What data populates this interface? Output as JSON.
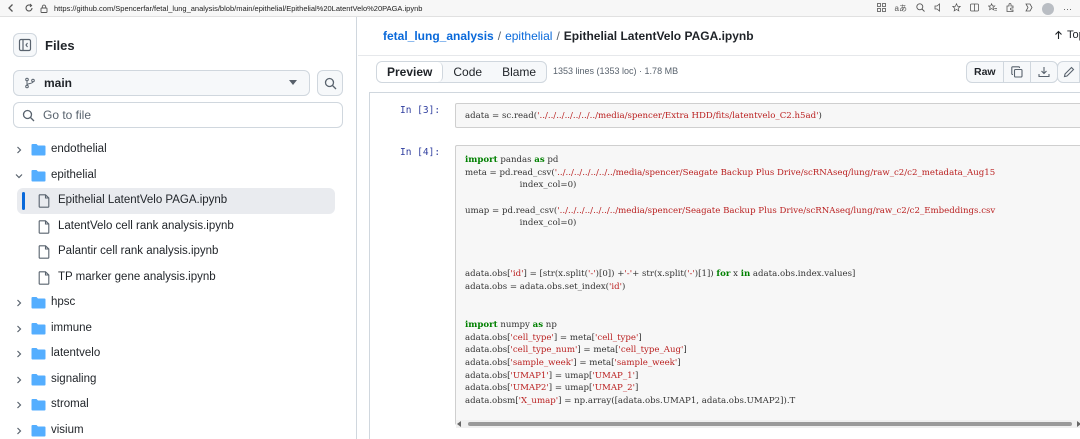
{
  "browser": {
    "url": "https://github.com/Spencerfar/fetal_lung_analysis/blob/main/epithelial/Epithelial%20LatentVelo%20PAGA.ipynb"
  },
  "sidebar": {
    "title": "Files",
    "branch": "main",
    "goto_placeholder": "Go to file",
    "items": [
      {
        "label": "endothelial",
        "type": "folder",
        "expanded": false
      },
      {
        "label": "epithelial",
        "type": "folder",
        "expanded": true
      },
      {
        "label": "Epithelial LatentVelo PAGA.ipynb",
        "type": "file",
        "selected": true
      },
      {
        "label": "LatentVelo cell rank analysis.ipynb",
        "type": "file"
      },
      {
        "label": "Palantir cell rank analysis.ipynb",
        "type": "file"
      },
      {
        "label": "TP marker gene analysis.ipynb",
        "type": "file"
      },
      {
        "label": "hpsc",
        "type": "folder",
        "expanded": false
      },
      {
        "label": "immune",
        "type": "folder",
        "expanded": false
      },
      {
        "label": "latentvelo",
        "type": "folder",
        "expanded": false
      },
      {
        "label": "signaling",
        "type": "folder",
        "expanded": false
      },
      {
        "label": "stromal",
        "type": "folder",
        "expanded": false
      },
      {
        "label": "visium",
        "type": "folder",
        "expanded": false
      }
    ]
  },
  "breadcrumb": {
    "repo": "fetal_lung_analysis",
    "sep": "/",
    "folder": "epithelial",
    "file": "Epithelial LatentVelo PAGA.ipynb"
  },
  "top_button": "Top",
  "toolbar": {
    "tabs": [
      "Preview",
      "Code",
      "Blame"
    ],
    "file_meta": "1353 lines (1353 loc) · 1.78 MB",
    "raw_label": "Raw"
  },
  "cells": [
    {
      "prompt": "In [3]:",
      "lines": [
        [
          [
            "t",
            "adata = sc.read("
          ],
          [
            "s",
            "'../../../../../../../media/spencer/Extra HDD/fits/latentvelo_C2.h5ad'"
          ],
          [
            "t",
            ")"
          ]
        ]
      ]
    },
    {
      "prompt": "In [4]:",
      "lines": [
        [
          [
            "k",
            "import"
          ],
          [
            "t",
            " pandas "
          ],
          [
            "k",
            "as"
          ],
          [
            "t",
            " pd"
          ]
        ],
        [
          [
            "t",
            "meta = pd.read_csv("
          ],
          [
            "s",
            "'../../../../../../../media/spencer/Seagate Backup Plus Drive/scRNAseq/lung/raw_c2/c2_metadata_Aug15"
          ]
        ],
        [
          [
            "t",
            "                    index_col=0)"
          ]
        ],
        [
          [
            "t",
            ""
          ]
        ],
        [
          [
            "t",
            "umap = pd.read_csv("
          ],
          [
            "s",
            "'../../../../../../../media/spencer/Seagate Backup Plus Drive/scRNAseq/lung/raw_c2/c2_Embeddings.csv"
          ]
        ],
        [
          [
            "t",
            "                    index_col=0)"
          ]
        ],
        [
          [
            "t",
            ""
          ]
        ],
        [
          [
            "t",
            ""
          ]
        ],
        [
          [
            "t",
            ""
          ]
        ],
        [
          [
            "t",
            "adata.obs["
          ],
          [
            "s",
            "'id'"
          ],
          [
            "t",
            "] = [str(x.split("
          ],
          [
            "s",
            "'-'"
          ],
          [
            "t",
            ")[0]) +"
          ],
          [
            "s",
            "'-'"
          ],
          [
            "t",
            "+ str(x.split("
          ],
          [
            "s",
            "'-'"
          ],
          [
            "t",
            ")[1]) "
          ],
          [
            "k",
            "for"
          ],
          [
            "t",
            " x "
          ],
          [
            "k",
            "in"
          ],
          [
            "t",
            " adata.obs.index.values]"
          ]
        ],
        [
          [
            "t",
            "adata.obs = adata.obs.set_index("
          ],
          [
            "s",
            "'id'"
          ],
          [
            "t",
            ")"
          ]
        ],
        [
          [
            "t",
            ""
          ]
        ],
        [
          [
            "t",
            ""
          ]
        ],
        [
          [
            "k",
            "import"
          ],
          [
            "t",
            " numpy "
          ],
          [
            "k",
            "as"
          ],
          [
            "t",
            " np"
          ]
        ],
        [
          [
            "t",
            "adata.obs["
          ],
          [
            "s",
            "'cell_type'"
          ],
          [
            "t",
            "] = meta["
          ],
          [
            "s",
            "'cell_type'"
          ],
          [
            "t",
            "]"
          ]
        ],
        [
          [
            "t",
            "adata.obs["
          ],
          [
            "s",
            "'cell_type_num'"
          ],
          [
            "t",
            "] = meta["
          ],
          [
            "s",
            "'cell_type_Aug'"
          ],
          [
            "t",
            "]"
          ]
        ],
        [
          [
            "t",
            "adata.obs["
          ],
          [
            "s",
            "'sample_week'"
          ],
          [
            "t",
            "] = meta["
          ],
          [
            "s",
            "'sample_week'"
          ],
          [
            "t",
            "]"
          ]
        ],
        [
          [
            "t",
            "adata.obs["
          ],
          [
            "s",
            "'UMAP1'"
          ],
          [
            "t",
            "] = umap["
          ],
          [
            "s",
            "'UMAP_1'"
          ],
          [
            "t",
            "]"
          ]
        ],
        [
          [
            "t",
            "adata.obs["
          ],
          [
            "s",
            "'UMAP2'"
          ],
          [
            "t",
            "] = umap["
          ],
          [
            "s",
            "'UMAP_2'"
          ],
          [
            "t",
            "]"
          ]
        ],
        [
          [
            "t",
            "adata.obsm["
          ],
          [
            "s",
            "'X_umap'"
          ],
          [
            "t",
            "] = np.array([adata.obs.UMAP1, adata.obs.UMAP2]).T"
          ]
        ]
      ]
    }
  ]
}
